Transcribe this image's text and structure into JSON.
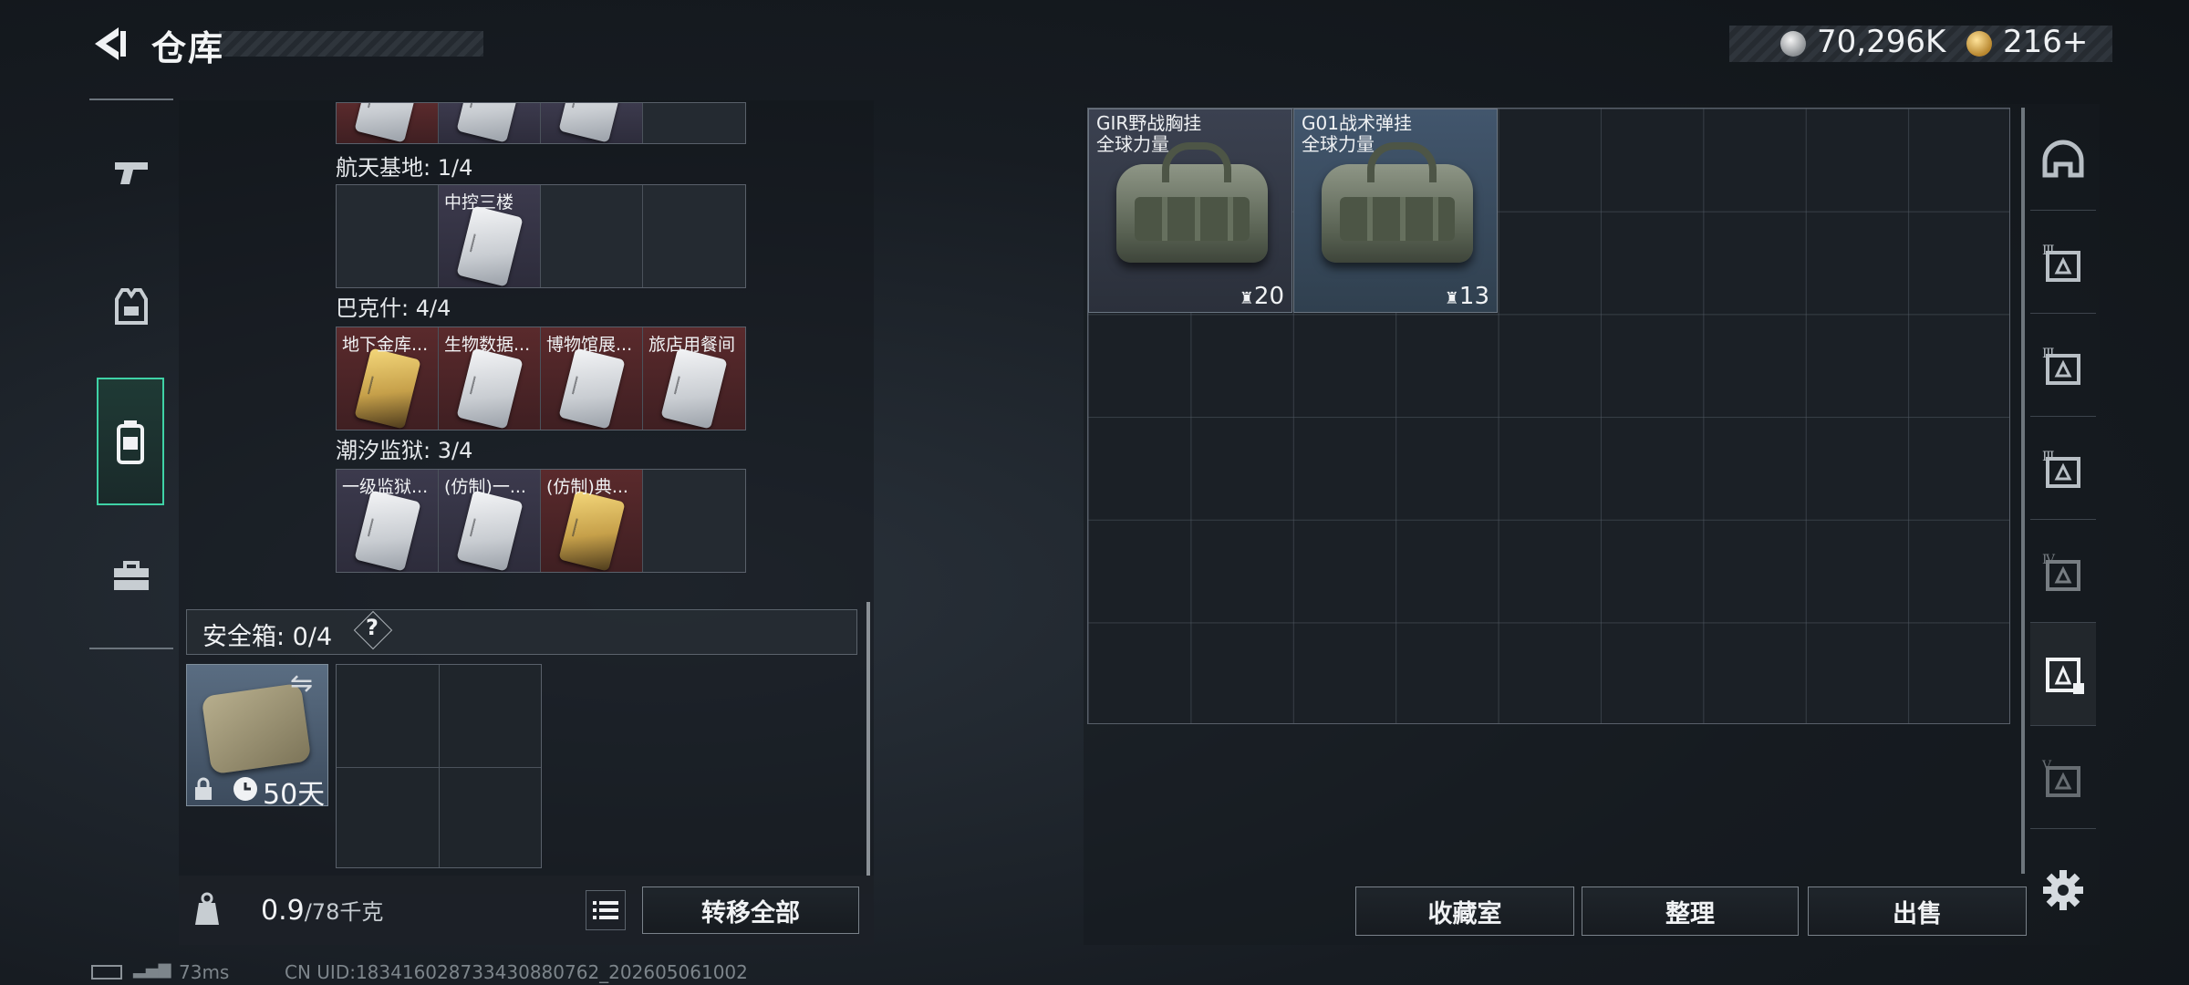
{
  "header": {
    "title": "仓库",
    "currency": {
      "silver": "70,296K",
      "gold": "216+"
    }
  },
  "nav": [
    "weapon-tab",
    "armor-tab",
    "bag-tab",
    "toolbox-tab"
  ],
  "collections": [
    {
      "name": "航天基地: 1/4",
      "cells": [
        {
          "label": "",
          "card": "",
          "bg": ""
        },
        {
          "label": "中控三楼",
          "card": "silver",
          "bg": "purple"
        },
        {
          "label": "",
          "card": "",
          "bg": ""
        },
        {
          "label": "",
          "card": "",
          "bg": ""
        }
      ]
    },
    {
      "name": "巴克什: 4/4",
      "cells": [
        {
          "label": "地下金库...",
          "card": "gold",
          "bg": "red"
        },
        {
          "label": "生物数据...",
          "card": "silver",
          "bg": "red"
        },
        {
          "label": "博物馆展...",
          "card": "silver",
          "bg": "red"
        },
        {
          "label": "旅店用餐间",
          "card": "silver",
          "bg": "red"
        }
      ]
    },
    {
      "name": "潮汐监狱: 3/4",
      "cells": [
        {
          "label": "一级监狱...",
          "card": "silver",
          "bg": "purple"
        },
        {
          "label": "(仿制)一...",
          "card": "silver",
          "bg": "purple"
        },
        {
          "label": "(仿制)典...",
          "card": "gold",
          "bg": "red"
        },
        {
          "label": "",
          "card": "",
          "bg": ""
        }
      ]
    }
  ],
  "safe": {
    "label": "安全箱: 0/4",
    "help": "?",
    "days": "50天"
  },
  "weight": {
    "current": "0.9",
    "max": "/78千克"
  },
  "buttons": {
    "transfer_all": "转移全部",
    "collection_room": "收藏室",
    "sort": "整理",
    "sell": "出售"
  },
  "stash_items": [
    {
      "name1": "GIR野战胸挂",
      "name2": "全球力量",
      "count": "20"
    },
    {
      "name1": "G01战术弹挂",
      "name2": "全球力量",
      "count": "13"
    }
  ],
  "side_tabs": [
    "",
    "Ⅲ",
    "Ⅲ",
    "Ⅲ",
    "Ⅳ",
    "",
    "Ⅴ"
  ],
  "status": {
    "ping": "73ms",
    "uid": "CN UID:183416028733430880762_202605061002"
  },
  "colors": {
    "accent": "#3fd2a6",
    "rare_red": "#5a2a2c",
    "purple": "#3c3a4d"
  }
}
